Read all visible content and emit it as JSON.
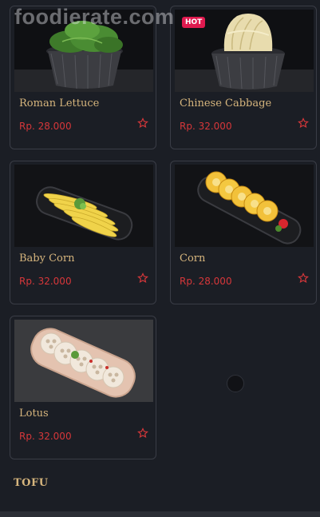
{
  "watermark": "foodierate.com",
  "items": [
    {
      "name": "Roman Lettuce",
      "price": "Rp. 28.000",
      "badge": ""
    },
    {
      "name": "Chinese Cabbage",
      "price": "Rp. 32.000",
      "badge": "HOT"
    },
    {
      "name": "Baby Corn",
      "price": "Rp. 32.000",
      "badge": ""
    },
    {
      "name": "Corn",
      "price": "Rp. 28.000",
      "badge": ""
    },
    {
      "name": "Lotus",
      "price": "Rp. 32.000",
      "badge": ""
    }
  ],
  "next_section": "TOFU",
  "colors": {
    "background": "#1b1e25",
    "card_border": "#3a3d46",
    "name_text": "#d6b57d",
    "price_text": "#d6373a",
    "hot_badge": "#e01a4f"
  },
  "icons": {
    "favorite": "star-outline-icon"
  }
}
